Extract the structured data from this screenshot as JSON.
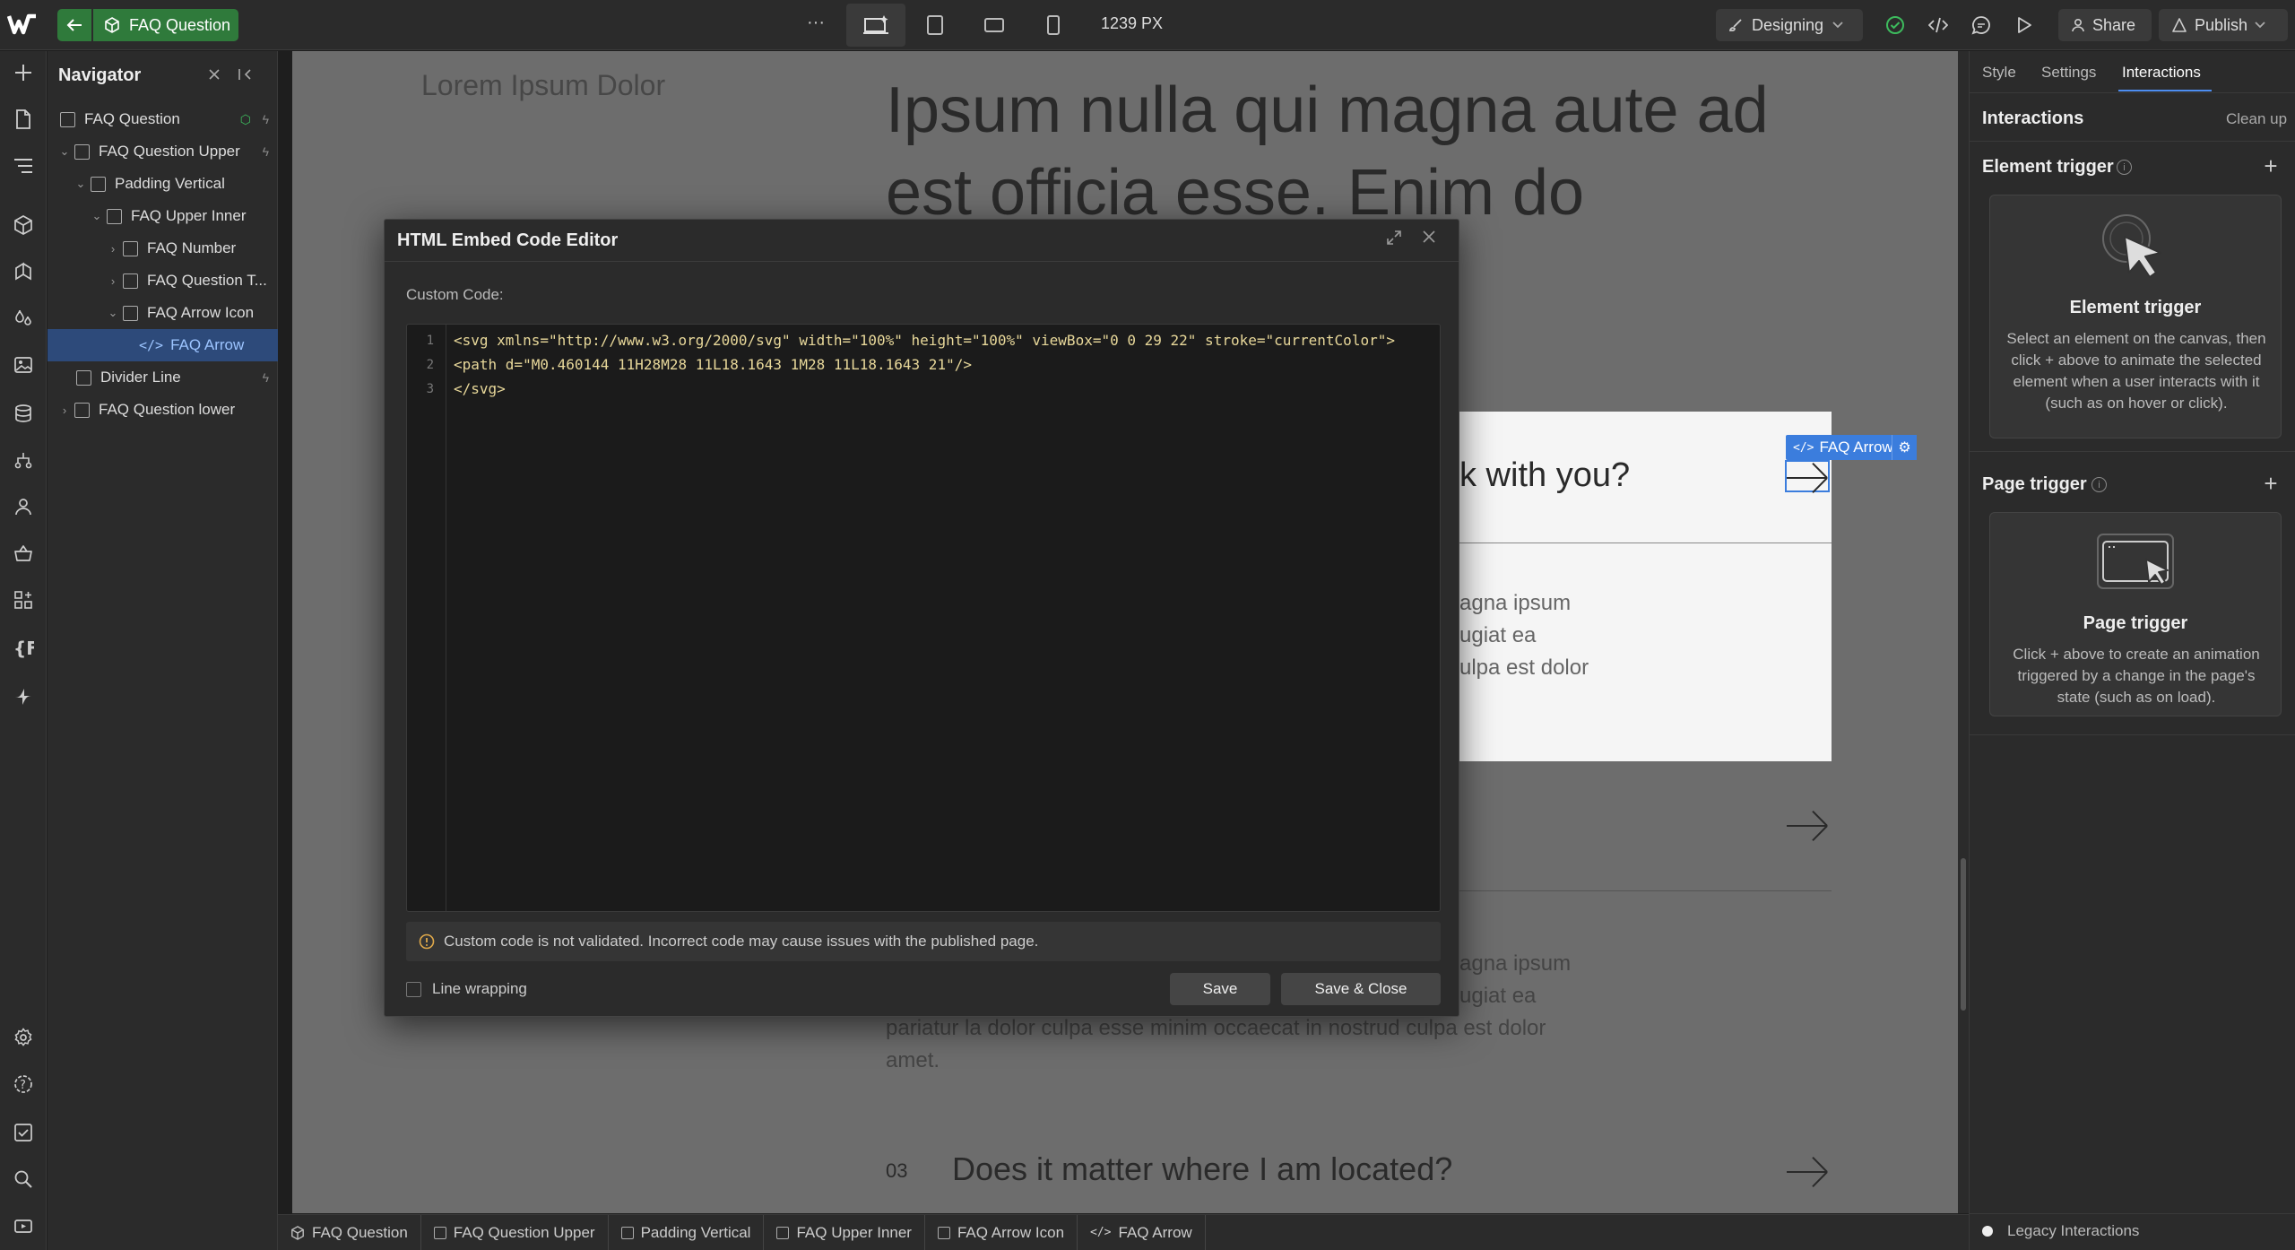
{
  "topbar": {
    "component_name": "FAQ Question",
    "more_label": "···",
    "canvas_width": "1239 PX",
    "mode": "Designing",
    "share": "Share",
    "publish": "Publish"
  },
  "navigator": {
    "title": "Navigator",
    "items": [
      {
        "label": "FAQ Question"
      },
      {
        "label": "FAQ Question Upper"
      },
      {
        "label": "Padding Vertical"
      },
      {
        "label": "FAQ Upper Inner"
      },
      {
        "label": "FAQ Number"
      },
      {
        "label": "FAQ Question T..."
      },
      {
        "label": "FAQ Arrow Icon"
      },
      {
        "label": "FAQ Arrow"
      },
      {
        "label": "Divider Line"
      },
      {
        "label": "FAQ Question lower"
      }
    ]
  },
  "canvas": {
    "lorem": "Lorem Ipsum Dolor",
    "heading_line1": "Ipsum nulla qui magna aute ad",
    "heading_line2": "est officia esse. Enim do",
    "card_question": "k with you?",
    "card_answer_l1": "agna ipsum",
    "card_answer_l2": "ugiat ea",
    "card_answer_l3": "ulpa est dolor",
    "answer2_l1": "agna ipsum",
    "answer2_l2": "ugiat ea",
    "answer2_l3": "pariatur la dolor culpa esse minim occaecat in nostrud culpa est dolor",
    "answer2_l4": "amet.",
    "q3_number": "03",
    "q3_text": "Does it matter where I am located?",
    "badge_label": "FAQ Arrow"
  },
  "dialog": {
    "title": "HTML Embed Code Editor",
    "custom_code_label": "Custom Code:",
    "code_lines": [
      "<svg xmlns=\"http://www.w3.org/2000/svg\" width=\"100%\" height=\"100%\" viewBox=\"0 0 29 22\" stroke=\"currentColor\">",
      "<path d=\"M0.460144 11H28M28 11L18.1643 1M28 11L18.1643 21\"/>",
      "</svg>"
    ],
    "line_numbers": [
      "1",
      "2",
      "3"
    ],
    "warning": "Custom code is not validated. Incorrect code may cause issues with the published page.",
    "line_wrapping": "Line wrapping",
    "save": "Save",
    "save_close": "Save & Close"
  },
  "right_panel": {
    "tabs": [
      "Style",
      "Settings",
      "Interactions"
    ],
    "active_tab": "Interactions",
    "section_title": "Interactions",
    "clean_up": "Clean up",
    "element_trigger": {
      "title": "Element trigger",
      "card_title": "Element trigger",
      "card_desc": "Select an element on the canvas, then click + above to animate the selected element when a user interacts with it (such as on hover or click)."
    },
    "page_trigger": {
      "title": "Page trigger",
      "card_title": "Page trigger",
      "card_desc": "Click + above to create an animation triggered by a change in the page's state (such as on load)."
    },
    "legacy": "Legacy Interactions"
  },
  "breadcrumb": [
    {
      "label": "FAQ Question",
      "icon": "component-icon"
    },
    {
      "label": "FAQ Question Upper",
      "icon": "box-icon"
    },
    {
      "label": "Padding Vertical",
      "icon": "box-icon"
    },
    {
      "label": "FAQ Upper Inner",
      "icon": "box-icon"
    },
    {
      "label": "FAQ Arrow Icon",
      "icon": "box-icon"
    },
    {
      "label": "FAQ Arrow",
      "icon": "code-icon"
    }
  ],
  "colors": {
    "accent_green": "#2f7a3b",
    "selection_blue": "#3b7ddd",
    "background": "#1e1e1e"
  }
}
